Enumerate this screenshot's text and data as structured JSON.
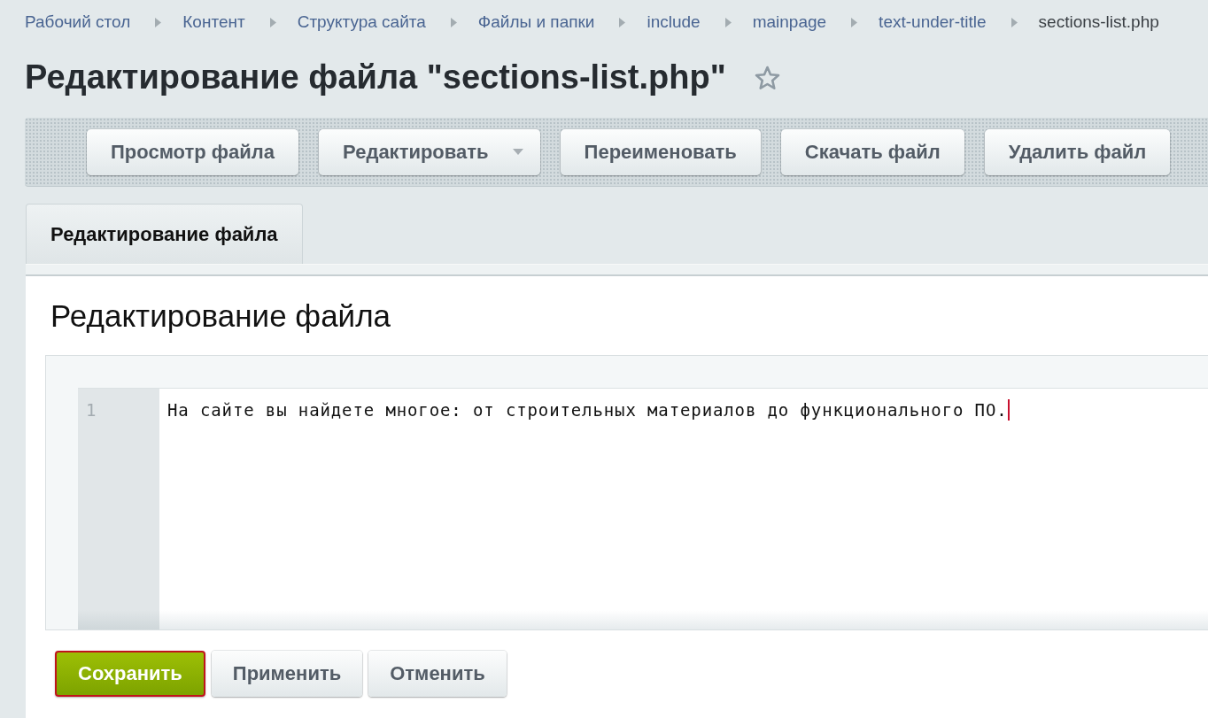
{
  "breadcrumbs": [
    {
      "label": "Рабочий стол",
      "current": false
    },
    {
      "label": "Контент",
      "current": false
    },
    {
      "label": "Структура сайта",
      "current": false
    },
    {
      "label": "Файлы и папки",
      "current": false
    },
    {
      "label": "include",
      "current": false
    },
    {
      "label": "mainpage",
      "current": false
    },
    {
      "label": "text-under-title",
      "current": false
    },
    {
      "label": "sections-list.php",
      "current": true
    }
  ],
  "page_title": "Редактирование файла \"sections-list.php\"",
  "starred": false,
  "toolbar": {
    "buttons": [
      {
        "label": "Просмотр файла",
        "has_menu": false
      },
      {
        "label": "Редактировать",
        "has_menu": true
      },
      {
        "label": "Переименовать",
        "has_menu": false
      },
      {
        "label": "Скачать файл",
        "has_menu": false
      },
      {
        "label": "Удалить файл",
        "has_menu": false
      }
    ]
  },
  "tabs": [
    {
      "label": "Редактирование файла",
      "selected": true
    }
  ],
  "panel": {
    "heading": "Редактирование файла",
    "editor": {
      "lines": [
        {
          "number": "1",
          "text": "На сайте вы найдете многое: от строительных материалов до функционального ПО.",
          "cursor": true
        }
      ]
    }
  },
  "buttons": [
    {
      "label": "Сохранить",
      "kind": "primary",
      "highlighted": true
    },
    {
      "label": "Применить",
      "kind": "default",
      "highlighted": false
    },
    {
      "label": "Отменить",
      "kind": "default",
      "highlighted": false
    }
  ]
}
